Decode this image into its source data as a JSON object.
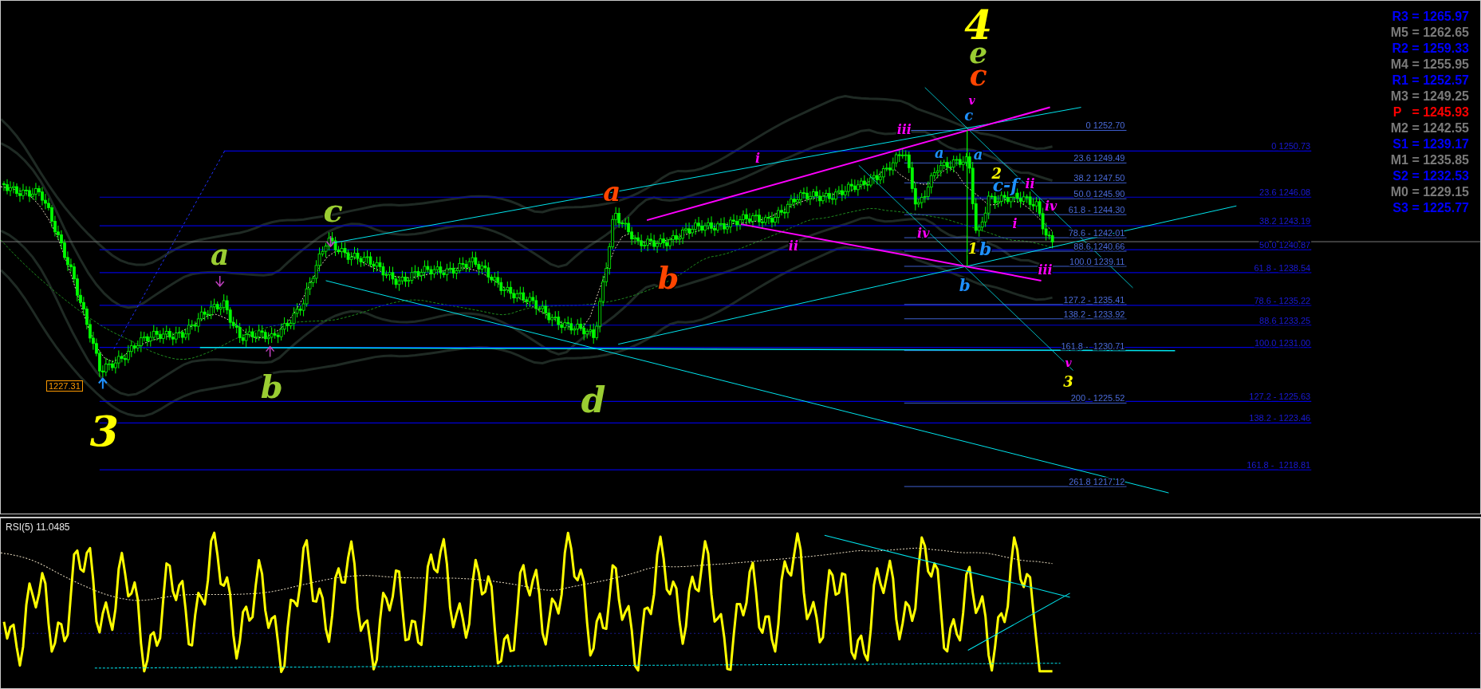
{
  "chart": {
    "wave_labels": [
      {
        "text": "3",
        "color": "#ffff00"
      },
      {
        "text": "a",
        "color": "#9acd32"
      },
      {
        "text": "b",
        "color": "#9acd32"
      },
      {
        "text": "c",
        "color": "#9acd32"
      },
      {
        "text": "d",
        "color": "#9acd32"
      },
      {
        "text": "a",
        "color": "#ff4500"
      },
      {
        "text": "b",
        "color": "#ff4500"
      },
      {
        "text": "4",
        "color": "#ffff00"
      },
      {
        "text": "e",
        "color": "#9acd32"
      },
      {
        "text": "c",
        "color": "#ff4500"
      },
      {
        "text": "v",
        "color": "#ff00ff"
      },
      {
        "text": "c",
        "color": "#1e90ff"
      },
      {
        "text": "iii",
        "color": "#ff00ff"
      },
      {
        "text": "i",
        "color": "#ff00ff"
      },
      {
        "text": "a",
        "color": "#1e90ff"
      },
      {
        "text": "a",
        "color": "#1e90ff"
      },
      {
        "text": "2",
        "color": "#ffff00"
      },
      {
        "text": "c-f",
        "color": "#1e90ff"
      },
      {
        "text": "ii",
        "color": "#ff00ff"
      },
      {
        "text": "iv",
        "color": "#ff00ff"
      },
      {
        "text": "i",
        "color": "#ff00ff"
      },
      {
        "text": "iv",
        "color": "#ff00ff"
      },
      {
        "text": "ii",
        "color": "#ff00ff"
      },
      {
        "text": "1",
        "color": "#ffff00"
      },
      {
        "text": "b",
        "color": "#1e90ff"
      },
      {
        "text": "b",
        "color": "#1e90ff"
      },
      {
        "text": "iii",
        "color": "#ff00ff"
      },
      {
        "text": "v",
        "color": "#ff00ff"
      },
      {
        "text": "3",
        "color": "#ffff00"
      }
    ],
    "price_tag": "1227.31",
    "fib_levels_near": [
      "0 1252.70",
      "23.6 1249.49",
      "38.2 1247.50",
      "50.0 1245.90",
      "61.8 - 1244.30",
      "78.6 - 1242.01",
      "88.6 1240.66",
      "100.0 1239.11",
      "127.2 - 1235.41",
      "138.2 - 1233.92",
      "161.8 -  1230.71",
      "200 - 1225.52",
      "261.8 1217.12"
    ],
    "fib_levels_far": [
      "0 1250.73",
      "23.6 1246.08",
      "38.2 1243.19",
      "50.0 1240.87",
      "61.8 - 1238.54",
      "78.6 - 1235.22",
      "88.6 1233.25",
      "100.0 1231.00",
      "127.2 - 1225.63",
      "138.2 - 1223.46",
      "161.8 -  1218.81"
    ]
  },
  "pivots": [
    {
      "text": "R3 = 1265.97",
      "kind": "resistance"
    },
    {
      "text": "M5 = 1262.65",
      "kind": "mid"
    },
    {
      "text": "R2 = 1259.33",
      "kind": "resistance"
    },
    {
      "text": "M4 = 1255.95",
      "kind": "mid"
    },
    {
      "text": "R1 = 1252.57",
      "kind": "resistance"
    },
    {
      "text": "M3 = 1249.25",
      "kind": "mid"
    },
    {
      "text": "P   = 1245.93",
      "kind": "pivot"
    },
    {
      "text": "M2 = 1242.55",
      "kind": "mid"
    },
    {
      "text": "S1 = 1239.17",
      "kind": "support"
    },
    {
      "text": "M1 = 1235.85",
      "kind": "mid"
    },
    {
      "text": "S2 = 1232.53",
      "kind": "support"
    },
    {
      "text": "M0 = 1229.15",
      "kind": "mid"
    },
    {
      "text": "S3 = 1225.77",
      "kind": "support"
    }
  ],
  "rsi": {
    "label": "RSI(5) 11.0485"
  }
}
